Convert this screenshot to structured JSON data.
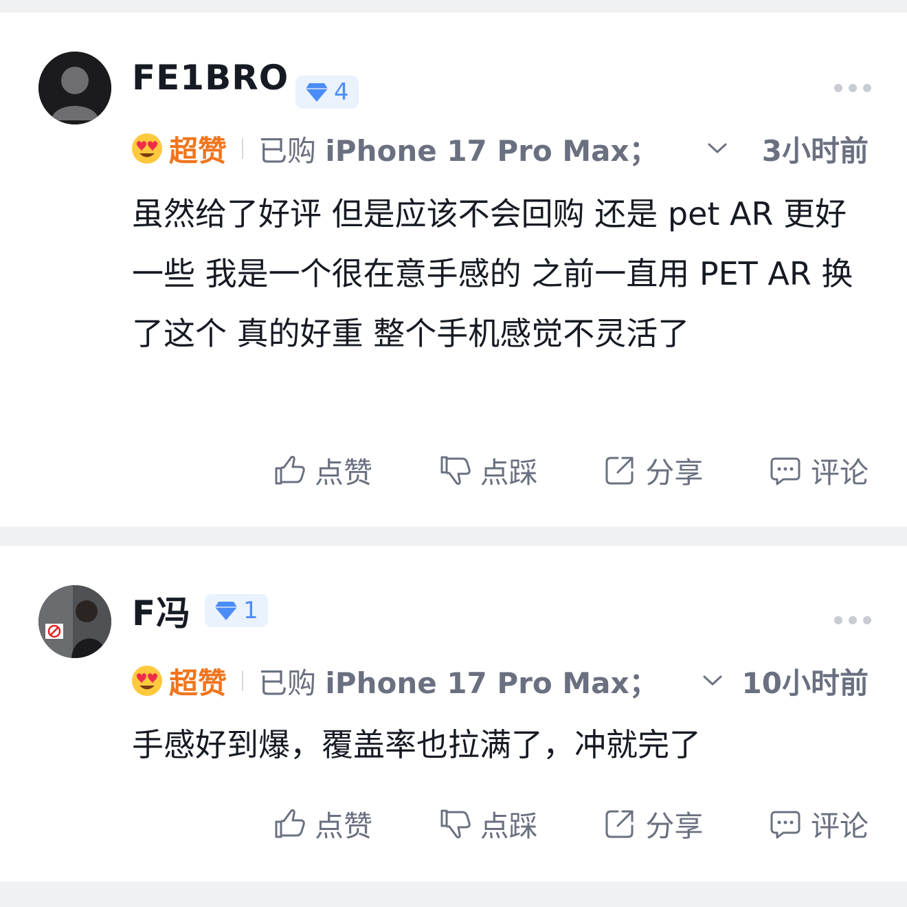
{
  "comments": [
    {
      "username": "FE1BRO",
      "level": "4",
      "rating_label": "超赞",
      "purchase_prefix": "已购",
      "purchase_product": "iPhone 17 Pro Max；",
      "time": "3小时前",
      "text": "虽然给了好评 但是应该不会回购 还是 pet AR 更好一些  我是一个很在意手感的 之前一直用 PET AR 换了这个 真的好重 整个手机感觉不灵活了",
      "actions": {
        "like": "点赞",
        "dislike": "点踩",
        "share": "分享",
        "comment": "评论"
      }
    },
    {
      "username": "F冯",
      "level": "1",
      "rating_label": "超赞",
      "purchase_prefix": "已购",
      "purchase_product": "iPhone 17 Pro Max；",
      "time": "10小时前",
      "text": "手感好到爆，覆盖率也拉满了，冲就完了",
      "actions": {
        "like": "点赞",
        "dislike": "点踩",
        "share": "分享",
        "comment": "评论"
      }
    }
  ],
  "colors": {
    "accent": "#f0751d",
    "badge_text": "#4b8df8",
    "badge_bg": "#eaf2fe",
    "muted": "#6a7080"
  },
  "icons": [
    "avatar",
    "diamond-icon",
    "more-icon",
    "heart-eyes-emoji-icon",
    "chevron-down-icon",
    "thumbs-up-icon",
    "thumbs-down-icon",
    "share-icon",
    "comment-icon"
  ]
}
